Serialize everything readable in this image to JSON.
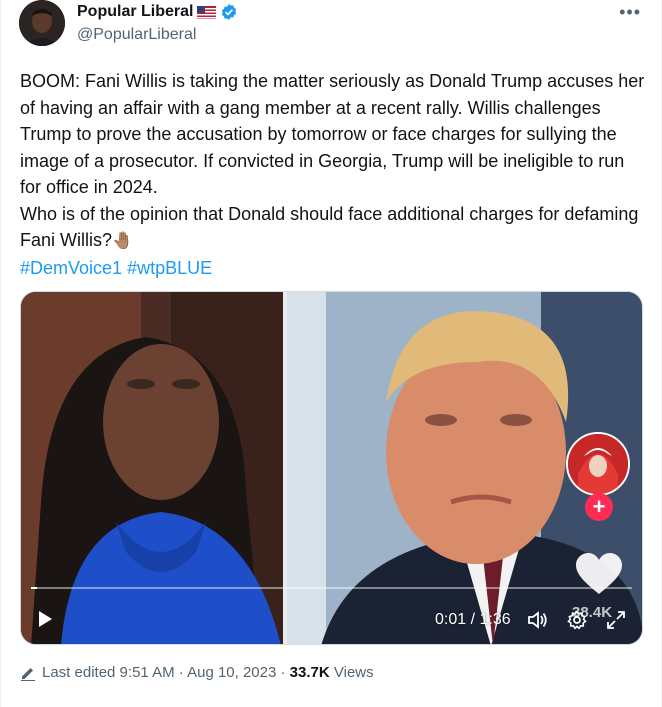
{
  "author": {
    "display_name": "Popular Liberal",
    "handle": "@PopularLiberal",
    "flag_icon": "us-flag-icon",
    "verified_icon": "verified-badge-icon",
    "verified_color": "#1d9bf0"
  },
  "tweet": {
    "paragraph1": "BOOM: Fani Willis is taking the matter seriously as Donald Trump accuses her of having an affair with a gang member at a recent rally. Willis challenges Trump to prove the accusation by tomorrow or face charges for sullying the image of a prosecutor. If convicted in Georgia, Trump will be ineligible to run for office in 2024.",
    "paragraph2": "Who is of the opinion that Donald should face additional charges for defaming Fani Willis?",
    "emoji": "🤚🏽",
    "hashtags": [
      "#DemVoice1",
      "#wtpBLUE"
    ]
  },
  "video": {
    "time": "0:01 / 1:36",
    "progress": 0.01,
    "likes_overlay": "38.4K",
    "icons": {
      "play": "play-icon",
      "volume": "volume-icon",
      "settings": "gear-icon",
      "fullscreen": "expand-icon",
      "like": "heart-icon",
      "follow": "plus-icon"
    }
  },
  "meta": {
    "edited": "Last edited 9:51 AM · Aug 10, 2023 · ",
    "views_count": "33.7K",
    "views_label": "Views"
  },
  "colors": {
    "text": "#0f1419",
    "secondary": "#536471",
    "link": "#1d9bf0",
    "tiktok_red": "#fe2c55"
  }
}
